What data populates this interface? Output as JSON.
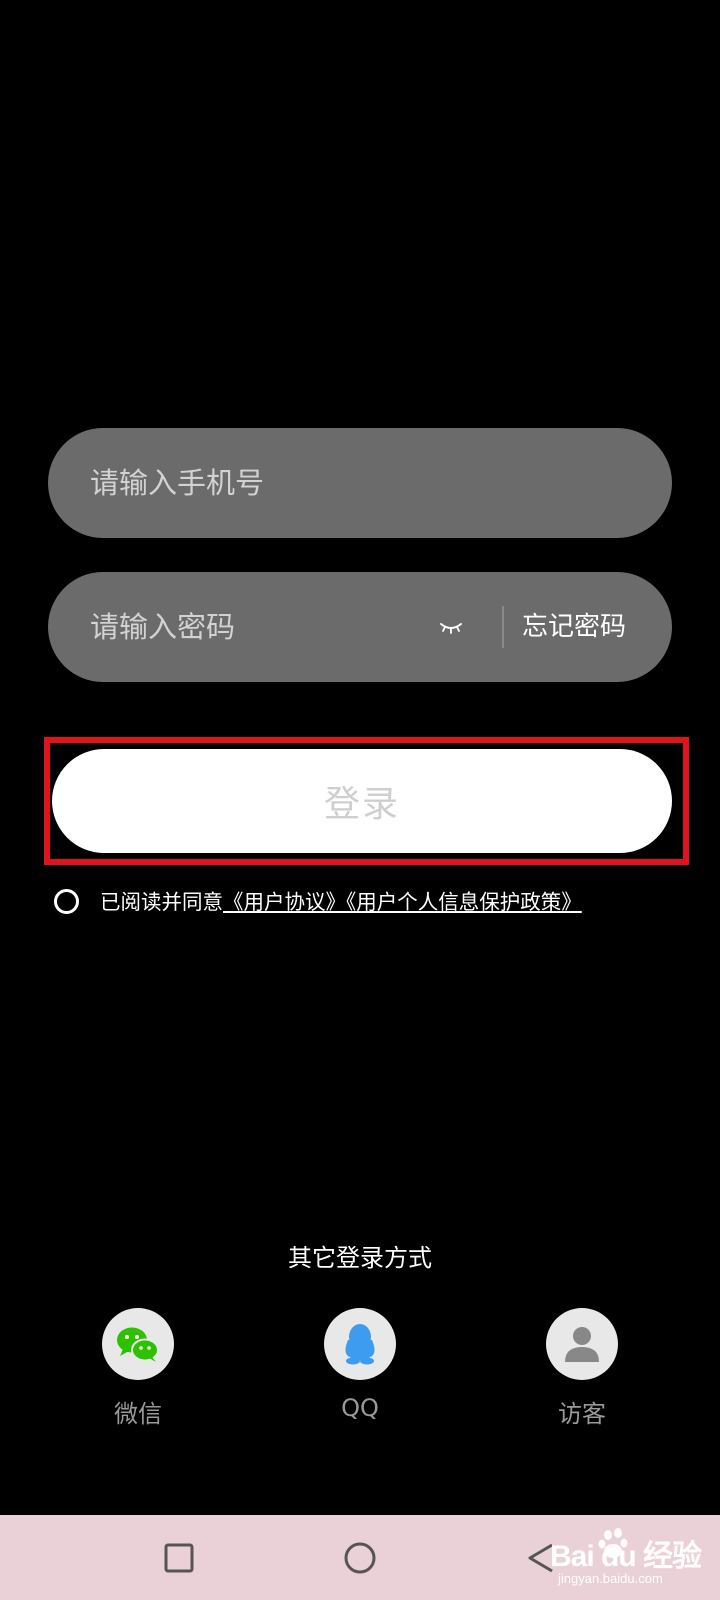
{
  "login_form": {
    "phone": {
      "value": "",
      "placeholder": "请输入手机号"
    },
    "password": {
      "value": "",
      "placeholder": "请输入密码"
    },
    "forgot_password": "忘记密码",
    "login_button": "登录"
  },
  "agreement": {
    "prefix": "已阅读并同意",
    "user_agreement": "《用户协议》",
    "privacy_policy": "《用户个人信息保护政策》"
  },
  "other_login": {
    "title": "其它登录方式",
    "options": [
      {
        "label": "微信",
        "icon": "wechat-icon"
      },
      {
        "label": "QQ",
        "icon": "qq-icon"
      },
      {
        "label": "访客",
        "icon": "guest-user-icon"
      }
    ]
  },
  "navigation": {
    "buttons": [
      "recent-apps-icon",
      "home-icon",
      "back-icon"
    ]
  },
  "watermark": {
    "logo_text": "Bai du 经验",
    "url": "jingyan.baidu.com"
  },
  "colors": {
    "background": "#000000",
    "input_background": "#6b6b6b",
    "highlight": "#e0141b",
    "wechat_green": "#2dc100",
    "qq_blue": "#3d9bf0",
    "nav_background": "#ead0d7"
  }
}
